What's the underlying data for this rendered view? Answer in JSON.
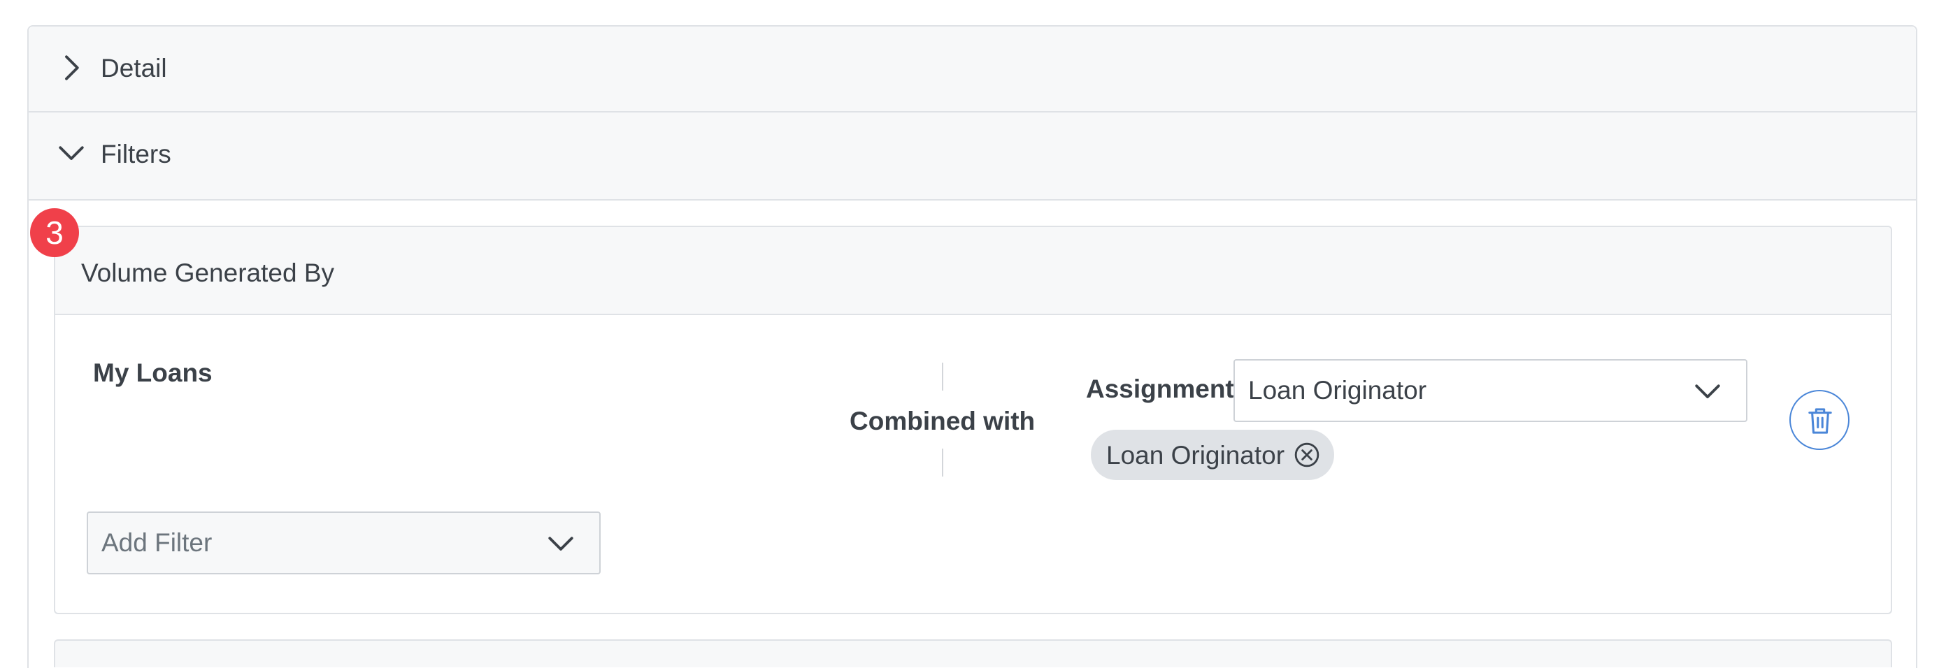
{
  "accordion": {
    "detail": {
      "label": "Detail",
      "expanded": false,
      "icon": "chevron-right-icon"
    },
    "filters": {
      "label": "Filters",
      "expanded": true,
      "icon": "chevron-down-icon"
    }
  },
  "step_badge": "3",
  "filter_card": {
    "title": "Volume Generated By",
    "group_label": "My Loans",
    "combined_label": "Combined with",
    "assignment": {
      "label": "Assignment",
      "selected": "Loan Originator",
      "tags": [
        "Loan Originator"
      ]
    },
    "add_filter_placeholder": "Add Filter",
    "delete_icon": "trash-icon"
  },
  "colors": {
    "badge": "#f0404a",
    "accent": "#4a86d8",
    "header_bg": "#f7f8f9",
    "border": "#dfe2e6"
  }
}
